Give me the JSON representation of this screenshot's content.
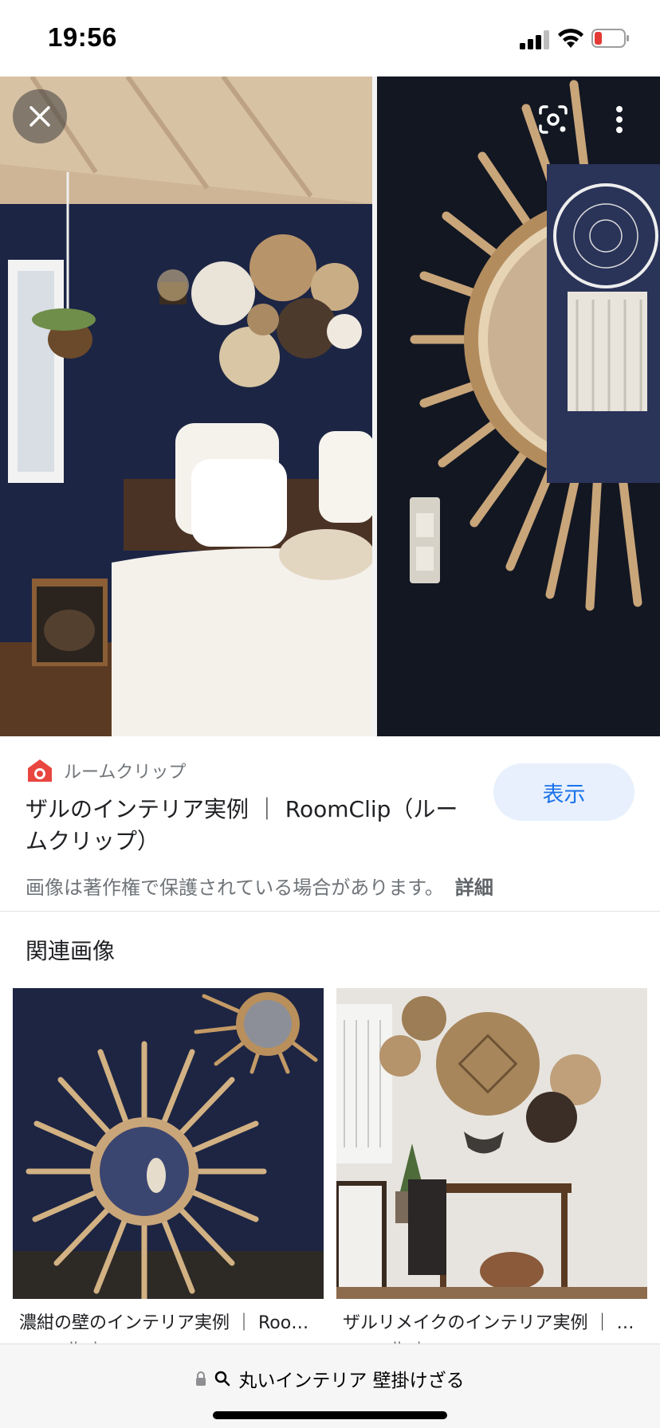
{
  "status_bar": {
    "time": "19:56"
  },
  "hero": {
    "close_icon": "close-icon",
    "lens_icon": "lens-icon",
    "more_icon": "more-vert-icon"
  },
  "result": {
    "source_name": "ルームクリップ",
    "title": "ザルのインテリア実例 ｜ RoomClip（ルームクリップ）",
    "view_button_label": "表示",
    "copyright_text": "画像は著作権で保護されている場合があります。",
    "details_link": "詳細"
  },
  "related": {
    "heading": "関連画像",
    "items": [
      {
        "title": "濃紺の壁のインテリア実例 ｜ Roo…",
        "domain": "roomclip.jp"
      },
      {
        "title": "ザルリメイクのインテリア実例 ｜ …",
        "domain": "roomclip.jp"
      }
    ]
  },
  "address_bar": {
    "query": "丸いインテリア 壁掛けざる"
  },
  "colors": {
    "accent": "#1a73e8",
    "button_bg": "#e8f0fe",
    "wall_navy": "#1b2340",
    "rattan": "#c9a57a"
  }
}
